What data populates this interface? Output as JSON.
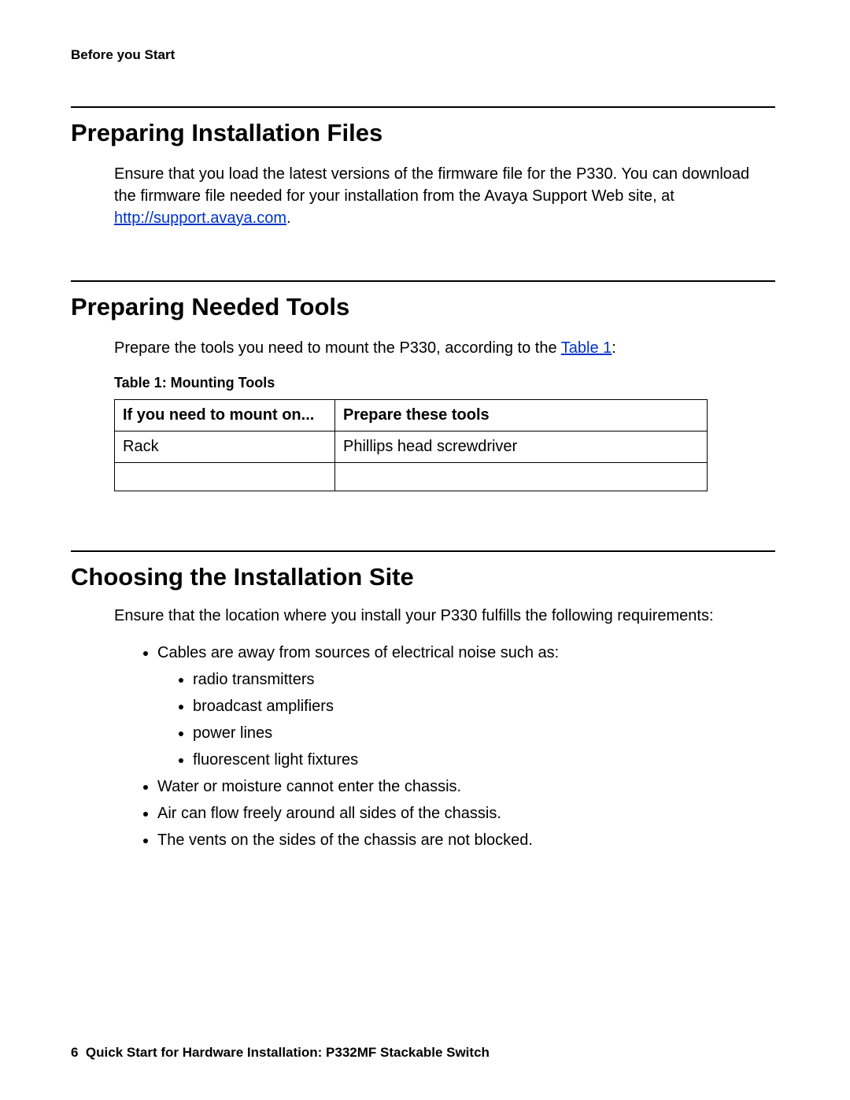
{
  "header": {
    "running_title": "Before you Start"
  },
  "sections": {
    "prep_files": {
      "heading": "Preparing Installation Files",
      "para_a": "Ensure that you load the latest versions of the firmware file for the P330. You can download the firmware file needed for your installation from the Avaya Support Web site, at ",
      "link_text": "http://support.avaya.com",
      "para_b": "."
    },
    "prep_tools": {
      "heading": "Preparing Needed Tools",
      "para_a": "Prepare the tools you need to mount the P330, according to the ",
      "link_text": "Table 1",
      "para_b": ":",
      "table_caption": "Table 1: Mounting Tools",
      "table": {
        "headers": {
          "c1": "If you need to mount on...",
          "c2": "Prepare these tools"
        },
        "rows": [
          {
            "c1": "Rack",
            "c2": "Phillips head screwdriver"
          },
          {
            "c1": "",
            "c2": ""
          }
        ]
      }
    },
    "site": {
      "heading": "Choosing the Installation Site",
      "intro": "Ensure that the location where you install your P330 fulfills the following requirements:",
      "bullets": {
        "b1": "Cables are away from sources of electrical noise such as:",
        "b1_sub": {
          "s1": "radio transmitters",
          "s2": "broadcast amplifiers",
          "s3": "power lines",
          "s4": "fluorescent light fixtures"
        },
        "b2": "Water or moisture cannot enter the chassis.",
        "b3": "Air can flow freely around all sides of the chassis.",
        "b4": "The vents on the sides of the chassis are not blocked."
      }
    }
  },
  "footer": {
    "page_number": "6",
    "doc_title": "Quick Start for Hardware Installation: P332MF Stackable Switch"
  }
}
